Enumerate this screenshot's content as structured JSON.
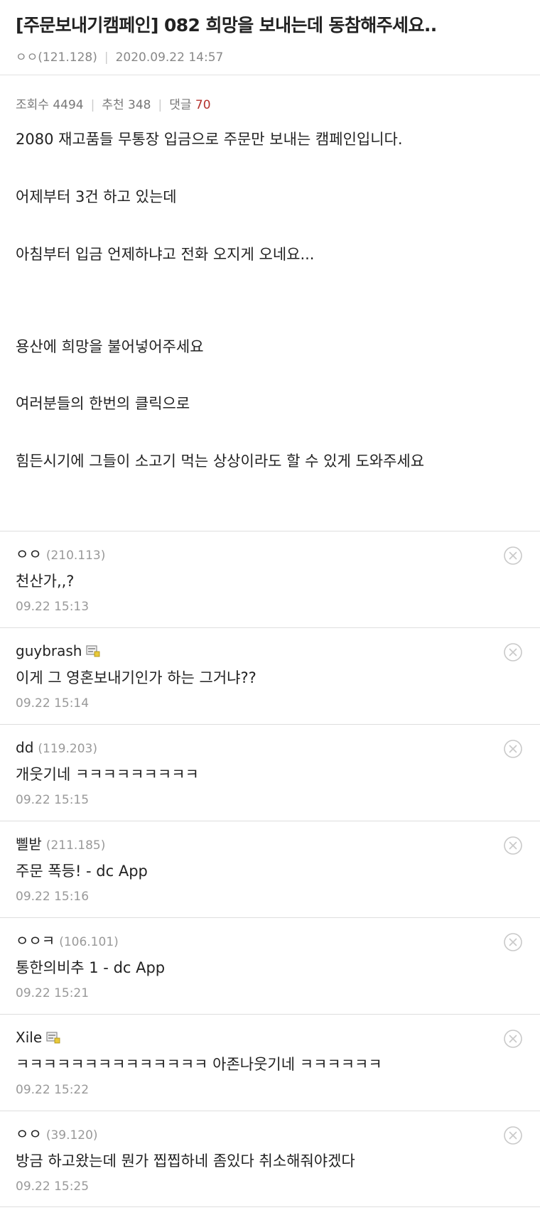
{
  "post": {
    "title": "[주문보내기캠페인] 082 희망을 보내는데 동참해주세요..",
    "author": "ㅇㅇ(121.128)",
    "date": "2020.09.22 14:57",
    "views_label": "조회수 4494",
    "recommend_label": "추천 348",
    "comments_label": "댓글",
    "comments_count": "70",
    "body": [
      "2080 재고품들 무통장 입금으로 주문만 보내는 캠페인입니다.",
      "어제부터 3건 하고 있는데",
      "아침부터 입금 언제하냐고 전화 오지게 오네요...",
      "용산에 희망을 불어넣어주세요",
      "여러분들의 한번의 클릭으로",
      "힘든시기에 그들이 소고기 먹는 상상이라도 할 수 있게 도와주세요"
    ]
  },
  "comments": [
    {
      "name": "ㅇㅇ",
      "ip": "(210.113)",
      "text": "천산가,,?",
      "time": "09.22 15:13"
    },
    {
      "name": "guybrash",
      "ip": "",
      "text": "이게 그 영혼보내기인가 하는 그거냐??",
      "time": "09.22 15:14"
    },
    {
      "name": "dd",
      "ip": "(119.203)",
      "text": "개웃기네 ㅋㅋㅋㅋㅋㅋㅋㅋㅋ",
      "time": "09.22 15:15"
    },
    {
      "name": "삘받",
      "ip": "(211.185)",
      "text": "주문 폭등! - dc App",
      "time": "09.22 15:16"
    },
    {
      "name": "ㅇㅇㅋ",
      "ip": "(106.101)",
      "text": "통한의비추 1 - dc App",
      "time": "09.22 15:21"
    },
    {
      "name": "Xile",
      "ip": "",
      "text": "ㅋㅋㅋㅋㅋㅋㅋㅋㅋㅋㅋㅋㅋㅋ 아존나웃기네 ㅋㅋㅋㅋㅋㅋ",
      "time": "09.22 15:22"
    },
    {
      "name": "ㅇㅇ",
      "ip": "(39.120)",
      "text": "방금 하고왔는데 뭔가 찝찝하네 좀있다 취소해줘야겠다",
      "time": "09.22 15:25"
    }
  ],
  "icons": {
    "delete": "delete-circle-icon",
    "gallog": "gallog-member-icon"
  },
  "colors": {
    "comment_count": "#b4312d",
    "meta_gray": "#888888",
    "divider": "#dedede"
  }
}
